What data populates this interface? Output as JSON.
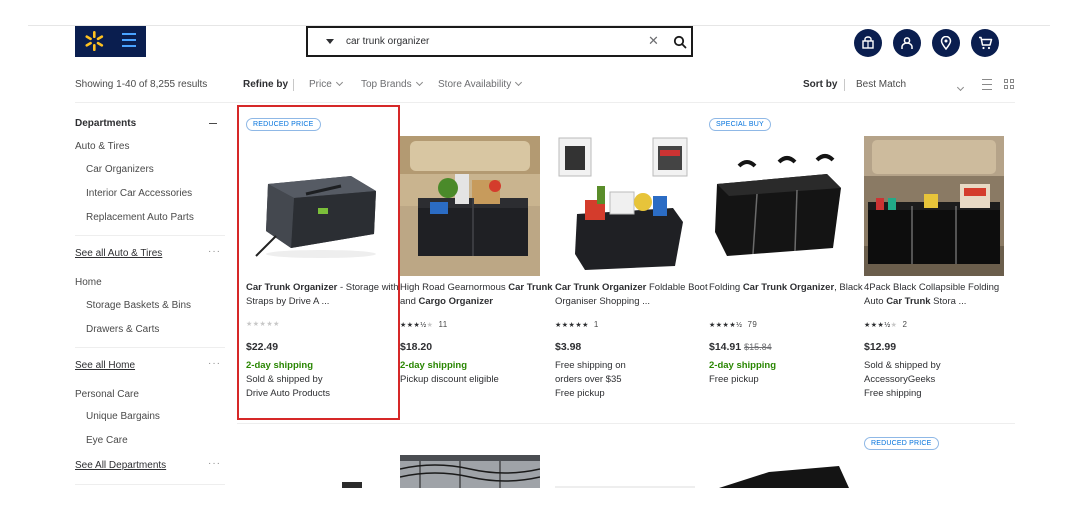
{
  "header": {
    "search_query": "car trunk organizer",
    "icons": [
      "reorder-icon",
      "account-icon",
      "location-icon",
      "cart-icon"
    ]
  },
  "results": {
    "showing": "Showing 1-40 of 8,255 results",
    "refine_by": "Refine by",
    "filters": [
      "Price",
      "Top Brands",
      "Store Availability"
    ],
    "sort_by": "Sort by",
    "sort_value": "Best Match"
  },
  "sidebar": {
    "departments": "Departments",
    "auto_tires": "Auto & Tires",
    "car_organizers": "Car Organizers",
    "interior_car_accessories": "Interior Car Accessories",
    "replacement_auto_parts": "Replacement Auto Parts",
    "see_all_auto": "See all Auto & Tires",
    "home": "Home",
    "storage_baskets": "Storage Baskets & Bins",
    "drawers_carts": "Drawers & Carts",
    "see_all_home": "See all Home",
    "personal_care": "Personal Care",
    "unique_bargains": "Unique Bargains",
    "eye_care": "Eye Care",
    "see_all_departments": "See All Departments",
    "more": "···"
  },
  "products": [
    {
      "badge": "REDUCED PRICE",
      "title_bold": "Car Trunk Organizer",
      "title_rest": " - Storage with Straps by Drive A ...",
      "rating": 0,
      "review_count": "",
      "price": "$22.49",
      "was_price": "",
      "line1": "2-day shipping",
      "line2": "Sold & shipped by",
      "line3": "Drive Auto Products"
    },
    {
      "badge": "",
      "title_pre": "High Road Gearnormous ",
      "title_bold": "Car Trunk",
      "title_mid": " and ",
      "title_bold2": "Cargo Organizer",
      "rating": 3.5,
      "review_count": "11",
      "price": "$18.20",
      "was_price": "",
      "line1": "2-day shipping",
      "line2": "Pickup discount eligible",
      "line3": ""
    },
    {
      "badge": "",
      "title_bold": "Car Trunk Organizer",
      "title_rest": " Foldable Boot Organiser Shopping ...",
      "rating": 5,
      "review_count": "1",
      "price": "$3.98",
      "was_price": "",
      "line1": "Free shipping on",
      "line2": "orders over $35",
      "line3": "Free pickup"
    },
    {
      "badge": "SPECIAL BUY",
      "title_pre": "Folding ",
      "title_bold": "Car Trunk Organizer",
      "title_rest": ", Black",
      "rating": 4.5,
      "review_count": "79",
      "price": "$14.91",
      "was_price": "$15.84",
      "line1": "2-day shipping",
      "line2": "Free pickup",
      "line3": ""
    },
    {
      "badge": "",
      "title_pre": "4Pack Black Collapsible Folding Auto ",
      "title_bold": "Car Trunk",
      "title_rest": " Stora ...",
      "rating": 3.5,
      "review_count": "2",
      "price": "$12.99",
      "was_price": "",
      "line1": "Sold & shipped by",
      "line2": "AccessoryGeeks",
      "line3": "Free shipping"
    }
  ],
  "row2": {
    "badge": "REDUCED PRICE"
  },
  "colors": {
    "brand_navy": "#0a1e4f",
    "brand_blue": "#0071dc",
    "spark_yellow": "#ffc220",
    "shipping_green": "#2a8703",
    "selection_red": "#d62828"
  }
}
